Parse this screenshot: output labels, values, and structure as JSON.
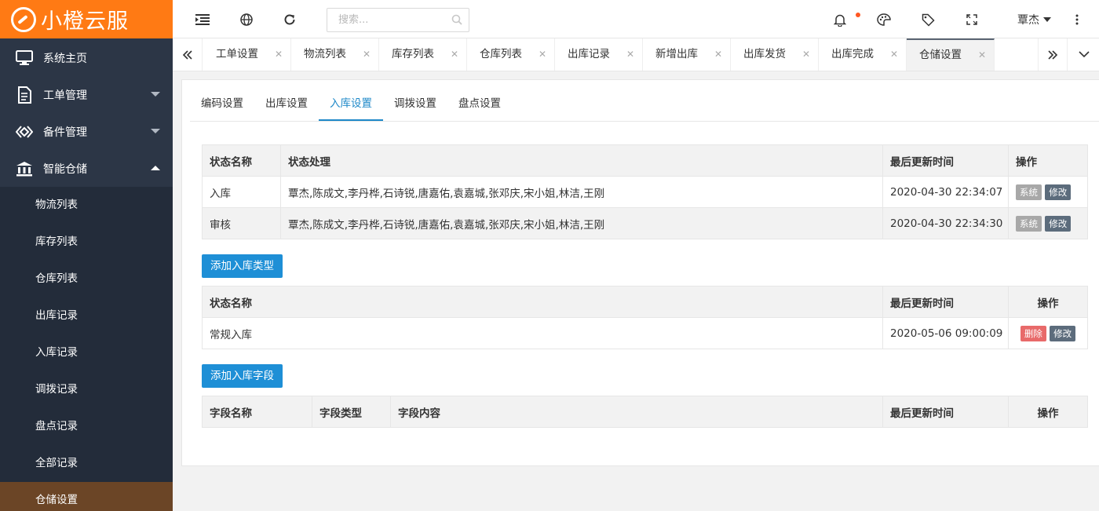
{
  "logo": {
    "text": "小橙云服"
  },
  "sidebar": {
    "home": "系统主页",
    "menus": [
      {
        "label": "工单管理"
      },
      {
        "label": "备件管理"
      },
      {
        "label": "智能仓储"
      }
    ],
    "sub_items": [
      "物流列表",
      "库存列表",
      "仓库列表",
      "出库记录",
      "入库记录",
      "调拨记录",
      "盘点记录",
      "全部记录",
      "仓储设置"
    ]
  },
  "header": {
    "search_placeholder": "搜索...",
    "user": "覃杰"
  },
  "tabs": [
    "工单设置",
    "物流列表",
    "库存列表",
    "仓库列表",
    "出库记录",
    "新增出库",
    "出库发货",
    "出库完成",
    "仓储设置"
  ],
  "subtabs": [
    "编码设置",
    "出库设置",
    "入库设置",
    "调拨设置",
    "盘点设置"
  ],
  "status_table": {
    "headers": [
      "状态名称",
      "状态处理",
      "最后更新时间",
      "操作"
    ],
    "rows": [
      {
        "name": "入库",
        "handlers": "覃杰,陈成文,李丹桦,石诗锐,唐嘉佑,袁嘉城,张邓庆,宋小姐,林洁,王刚",
        "time": "2020-04-30 22:34:07",
        "btn1": "系统",
        "btn2": "修改"
      },
      {
        "name": "审核",
        "handlers": "覃杰,陈成文,李丹桦,石诗锐,唐嘉佑,袁嘉城,张邓庆,宋小姐,林洁,王刚",
        "time": "2020-04-30 22:34:30",
        "btn1": "系统",
        "btn2": "修改"
      }
    ]
  },
  "add_type_button": "添加入库类型",
  "type_table": {
    "headers": [
      "状态名称",
      "最后更新时间",
      "操作"
    ],
    "rows": [
      {
        "name": "常规入库",
        "time": "2020-05-06 09:00:09",
        "btn1": "删除",
        "btn2": "修改"
      }
    ]
  },
  "add_field_button": "添加入库字段",
  "field_table": {
    "headers": [
      "字段名称",
      "字段类型",
      "字段内容",
      "最后更新时间",
      "操作"
    ]
  }
}
